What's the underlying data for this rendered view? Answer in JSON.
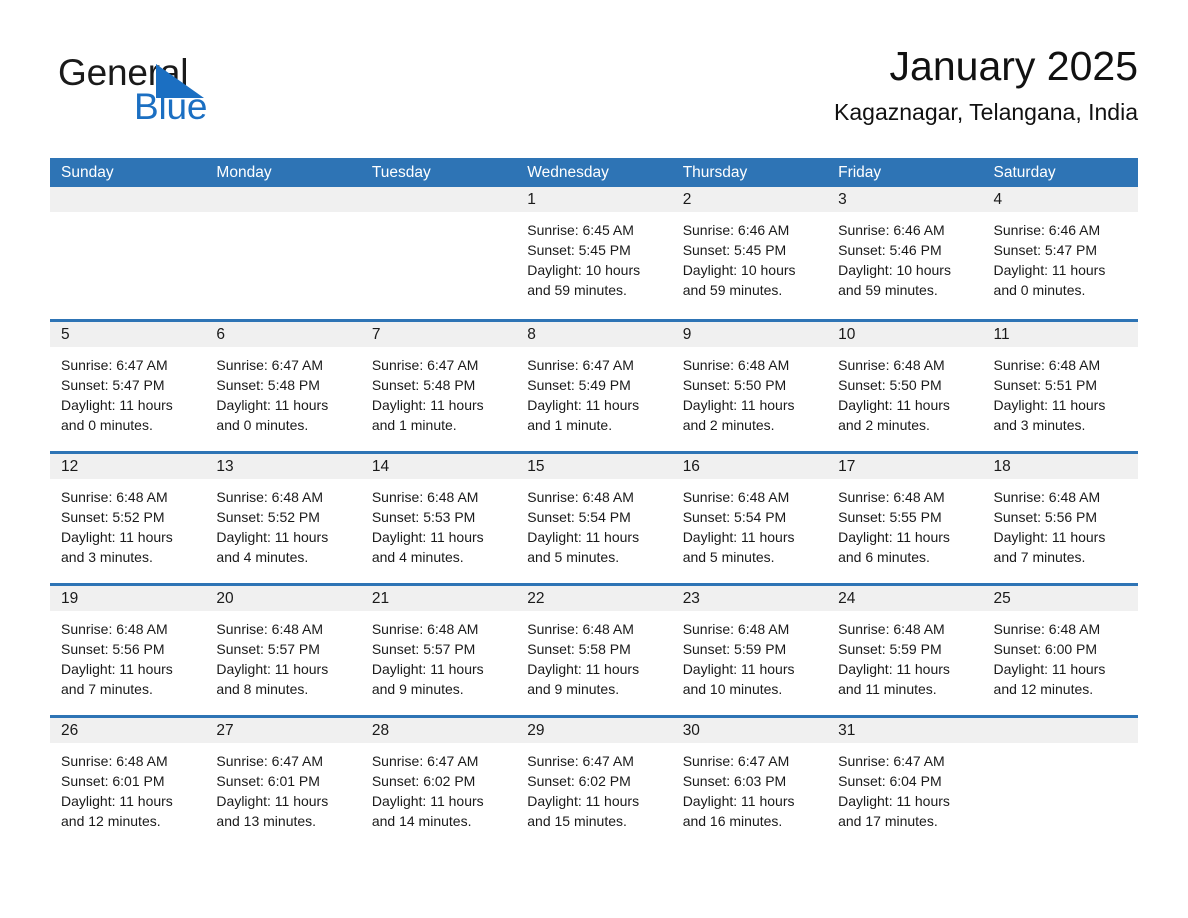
{
  "brand": {
    "name_part1": "General",
    "name_part2": "Blue",
    "triangle_color": "#1b6fc2"
  },
  "header": {
    "title": "January 2025",
    "subtitle": "Kagaznagar, Telangana, India"
  },
  "theme": {
    "header_bar_color": "#2e74b5",
    "day_number_band_color": "#f0f0f0",
    "text_color": "#1a1a1a"
  },
  "weekdays": [
    "Sunday",
    "Monday",
    "Tuesday",
    "Wednesday",
    "Thursday",
    "Friday",
    "Saturday"
  ],
  "weeks": [
    [
      {
        "day": "",
        "sunrise": "",
        "sunset": "",
        "daylight_line1": "",
        "daylight_line2": ""
      },
      {
        "day": "",
        "sunrise": "",
        "sunset": "",
        "daylight_line1": "",
        "daylight_line2": ""
      },
      {
        "day": "",
        "sunrise": "",
        "sunset": "",
        "daylight_line1": "",
        "daylight_line2": ""
      },
      {
        "day": "1",
        "sunrise": "Sunrise: 6:45 AM",
        "sunset": "Sunset: 5:45 PM",
        "daylight_line1": "Daylight: 10 hours",
        "daylight_line2": "and 59 minutes."
      },
      {
        "day": "2",
        "sunrise": "Sunrise: 6:46 AM",
        "sunset": "Sunset: 5:45 PM",
        "daylight_line1": "Daylight: 10 hours",
        "daylight_line2": "and 59 minutes."
      },
      {
        "day": "3",
        "sunrise": "Sunrise: 6:46 AM",
        "sunset": "Sunset: 5:46 PM",
        "daylight_line1": "Daylight: 10 hours",
        "daylight_line2": "and 59 minutes."
      },
      {
        "day": "4",
        "sunrise": "Sunrise: 6:46 AM",
        "sunset": "Sunset: 5:47 PM",
        "daylight_line1": "Daylight: 11 hours",
        "daylight_line2": "and 0 minutes."
      }
    ],
    [
      {
        "day": "5",
        "sunrise": "Sunrise: 6:47 AM",
        "sunset": "Sunset: 5:47 PM",
        "daylight_line1": "Daylight: 11 hours",
        "daylight_line2": "and 0 minutes."
      },
      {
        "day": "6",
        "sunrise": "Sunrise: 6:47 AM",
        "sunset": "Sunset: 5:48 PM",
        "daylight_line1": "Daylight: 11 hours",
        "daylight_line2": "and 0 minutes."
      },
      {
        "day": "7",
        "sunrise": "Sunrise: 6:47 AM",
        "sunset": "Sunset: 5:48 PM",
        "daylight_line1": "Daylight: 11 hours",
        "daylight_line2": "and 1 minute."
      },
      {
        "day": "8",
        "sunrise": "Sunrise: 6:47 AM",
        "sunset": "Sunset: 5:49 PM",
        "daylight_line1": "Daylight: 11 hours",
        "daylight_line2": "and 1 minute."
      },
      {
        "day": "9",
        "sunrise": "Sunrise: 6:48 AM",
        "sunset": "Sunset: 5:50 PM",
        "daylight_line1": "Daylight: 11 hours",
        "daylight_line2": "and 2 minutes."
      },
      {
        "day": "10",
        "sunrise": "Sunrise: 6:48 AM",
        "sunset": "Sunset: 5:50 PM",
        "daylight_line1": "Daylight: 11 hours",
        "daylight_line2": "and 2 minutes."
      },
      {
        "day": "11",
        "sunrise": "Sunrise: 6:48 AM",
        "sunset": "Sunset: 5:51 PM",
        "daylight_line1": "Daylight: 11 hours",
        "daylight_line2": "and 3 minutes."
      }
    ],
    [
      {
        "day": "12",
        "sunrise": "Sunrise: 6:48 AM",
        "sunset": "Sunset: 5:52 PM",
        "daylight_line1": "Daylight: 11 hours",
        "daylight_line2": "and 3 minutes."
      },
      {
        "day": "13",
        "sunrise": "Sunrise: 6:48 AM",
        "sunset": "Sunset: 5:52 PM",
        "daylight_line1": "Daylight: 11 hours",
        "daylight_line2": "and 4 minutes."
      },
      {
        "day": "14",
        "sunrise": "Sunrise: 6:48 AM",
        "sunset": "Sunset: 5:53 PM",
        "daylight_line1": "Daylight: 11 hours",
        "daylight_line2": "and 4 minutes."
      },
      {
        "day": "15",
        "sunrise": "Sunrise: 6:48 AM",
        "sunset": "Sunset: 5:54 PM",
        "daylight_line1": "Daylight: 11 hours",
        "daylight_line2": "and 5 minutes."
      },
      {
        "day": "16",
        "sunrise": "Sunrise: 6:48 AM",
        "sunset": "Sunset: 5:54 PM",
        "daylight_line1": "Daylight: 11 hours",
        "daylight_line2": "and 5 minutes."
      },
      {
        "day": "17",
        "sunrise": "Sunrise: 6:48 AM",
        "sunset": "Sunset: 5:55 PM",
        "daylight_line1": "Daylight: 11 hours",
        "daylight_line2": "and 6 minutes."
      },
      {
        "day": "18",
        "sunrise": "Sunrise: 6:48 AM",
        "sunset": "Sunset: 5:56 PM",
        "daylight_line1": "Daylight: 11 hours",
        "daylight_line2": "and 7 minutes."
      }
    ],
    [
      {
        "day": "19",
        "sunrise": "Sunrise: 6:48 AM",
        "sunset": "Sunset: 5:56 PM",
        "daylight_line1": "Daylight: 11 hours",
        "daylight_line2": "and 7 minutes."
      },
      {
        "day": "20",
        "sunrise": "Sunrise: 6:48 AM",
        "sunset": "Sunset: 5:57 PM",
        "daylight_line1": "Daylight: 11 hours",
        "daylight_line2": "and 8 minutes."
      },
      {
        "day": "21",
        "sunrise": "Sunrise: 6:48 AM",
        "sunset": "Sunset: 5:57 PM",
        "daylight_line1": "Daylight: 11 hours",
        "daylight_line2": "and 9 minutes."
      },
      {
        "day": "22",
        "sunrise": "Sunrise: 6:48 AM",
        "sunset": "Sunset: 5:58 PM",
        "daylight_line1": "Daylight: 11 hours",
        "daylight_line2": "and 9 minutes."
      },
      {
        "day": "23",
        "sunrise": "Sunrise: 6:48 AM",
        "sunset": "Sunset: 5:59 PM",
        "daylight_line1": "Daylight: 11 hours",
        "daylight_line2": "and 10 minutes."
      },
      {
        "day": "24",
        "sunrise": "Sunrise: 6:48 AM",
        "sunset": "Sunset: 5:59 PM",
        "daylight_line1": "Daylight: 11 hours",
        "daylight_line2": "and 11 minutes."
      },
      {
        "day": "25",
        "sunrise": "Sunrise: 6:48 AM",
        "sunset": "Sunset: 6:00 PM",
        "daylight_line1": "Daylight: 11 hours",
        "daylight_line2": "and 12 minutes."
      }
    ],
    [
      {
        "day": "26",
        "sunrise": "Sunrise: 6:48 AM",
        "sunset": "Sunset: 6:01 PM",
        "daylight_line1": "Daylight: 11 hours",
        "daylight_line2": "and 12 minutes."
      },
      {
        "day": "27",
        "sunrise": "Sunrise: 6:47 AM",
        "sunset": "Sunset: 6:01 PM",
        "daylight_line1": "Daylight: 11 hours",
        "daylight_line2": "and 13 minutes."
      },
      {
        "day": "28",
        "sunrise": "Sunrise: 6:47 AM",
        "sunset": "Sunset: 6:02 PM",
        "daylight_line1": "Daylight: 11 hours",
        "daylight_line2": "and 14 minutes."
      },
      {
        "day": "29",
        "sunrise": "Sunrise: 6:47 AM",
        "sunset": "Sunset: 6:02 PM",
        "daylight_line1": "Daylight: 11 hours",
        "daylight_line2": "and 15 minutes."
      },
      {
        "day": "30",
        "sunrise": "Sunrise: 6:47 AM",
        "sunset": "Sunset: 6:03 PM",
        "daylight_line1": "Daylight: 11 hours",
        "daylight_line2": "and 16 minutes."
      },
      {
        "day": "31",
        "sunrise": "Sunrise: 6:47 AM",
        "sunset": "Sunset: 6:04 PM",
        "daylight_line1": "Daylight: 11 hours",
        "daylight_line2": "and 17 minutes."
      },
      {
        "day": "",
        "sunrise": "",
        "sunset": "",
        "daylight_line1": "",
        "daylight_line2": ""
      }
    ]
  ]
}
